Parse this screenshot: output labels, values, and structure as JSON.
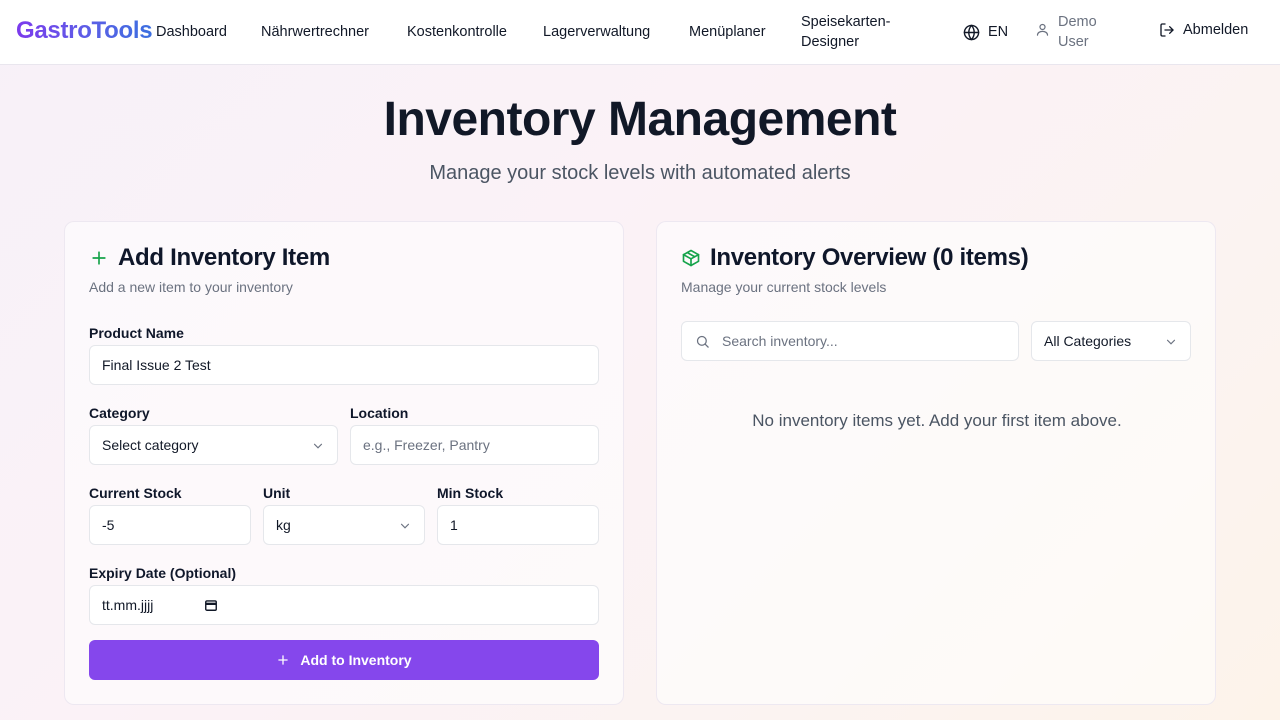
{
  "brand": "GastroTools",
  "nav": {
    "items": [
      "Dashboard",
      "Nährwertrechner",
      "Kostenkontrolle",
      "Lagerverwaltung",
      "Menüplaner",
      "Speisekarten-",
      "Designer"
    ],
    "language": "EN",
    "user_line1": "Demo",
    "user_line2": "User",
    "logout": "Abmelden"
  },
  "hero": {
    "title": "Inventory Management",
    "subtitle": "Manage your stock levels with automated alerts"
  },
  "add_form": {
    "title": "Add Inventory Item",
    "description": "Add a new item to your inventory",
    "product_name_label": "Product Name",
    "product_name_value": "Final Issue 2 Test",
    "category_label": "Category",
    "category_value": "Select category",
    "location_label": "Location",
    "location_placeholder": "e.g., Freezer, Pantry",
    "current_stock_label": "Current Stock",
    "current_stock_value": "-5",
    "unit_label": "Unit",
    "unit_value": "kg",
    "min_stock_label": "Min Stock",
    "min_stock_value": "1",
    "expiry_label": "Expiry Date (Optional)",
    "expiry_placeholder": "tt.mm.jjjj",
    "submit_label": "Add to Inventory"
  },
  "overview": {
    "title": "Inventory Overview (0 items)",
    "description": "Manage your current stock levels",
    "search_placeholder": "Search inventory...",
    "category_filter": "All Categories",
    "empty_message": "No inventory items yet. Add your first item above."
  },
  "colors": {
    "primary": "#8547ec",
    "accent_green": "#16a34a",
    "brand_start": "#7c3aed",
    "brand_end": "#3b6fe0"
  }
}
